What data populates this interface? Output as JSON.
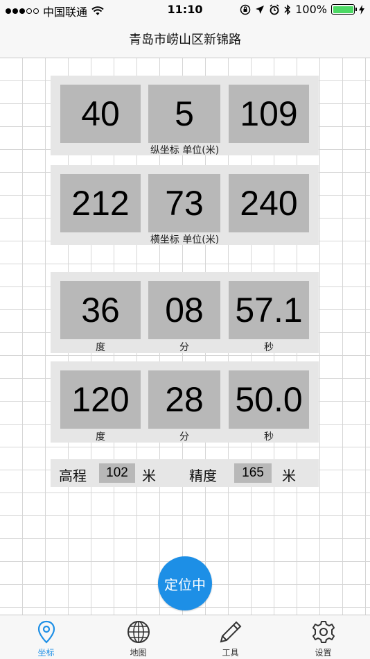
{
  "status_bar": {
    "carrier": "中国联通",
    "time": "11:10",
    "battery": "100%"
  },
  "nav": {
    "title": "青岛市崂山区新锦路"
  },
  "rows": [
    {
      "values": [
        "40",
        "5",
        "109"
      ],
      "caption": "纵坐标  单位(米)"
    },
    {
      "values": [
        "212",
        "73",
        "240"
      ],
      "caption": "横坐标  单位(米)"
    },
    {
      "values": [
        "36",
        "08",
        "57.1"
      ],
      "units": [
        "度",
        "分",
        "秒"
      ]
    },
    {
      "values": [
        "120",
        "28",
        "50.0"
      ],
      "units": [
        "度",
        "分",
        "秒"
      ]
    }
  ],
  "info": {
    "elevation_label": "高程",
    "elevation_value": "102",
    "elevation_unit": "米",
    "accuracy_label": "精度",
    "accuracy_value": "165",
    "accuracy_unit": "米"
  },
  "locate_button": "定位中",
  "tabs": [
    {
      "label": "坐标",
      "icon": "location-pin-icon",
      "active": true
    },
    {
      "label": "地图",
      "icon": "globe-icon",
      "active": false
    },
    {
      "label": "工具",
      "icon": "pencil-icon",
      "active": false
    },
    {
      "label": "设置",
      "icon": "gear-icon",
      "active": false
    }
  ],
  "colors": {
    "accent": "#1d8fe6",
    "cell": "#b8b8b8",
    "panel": "#e6e6e6",
    "battery": "#4cd964"
  }
}
